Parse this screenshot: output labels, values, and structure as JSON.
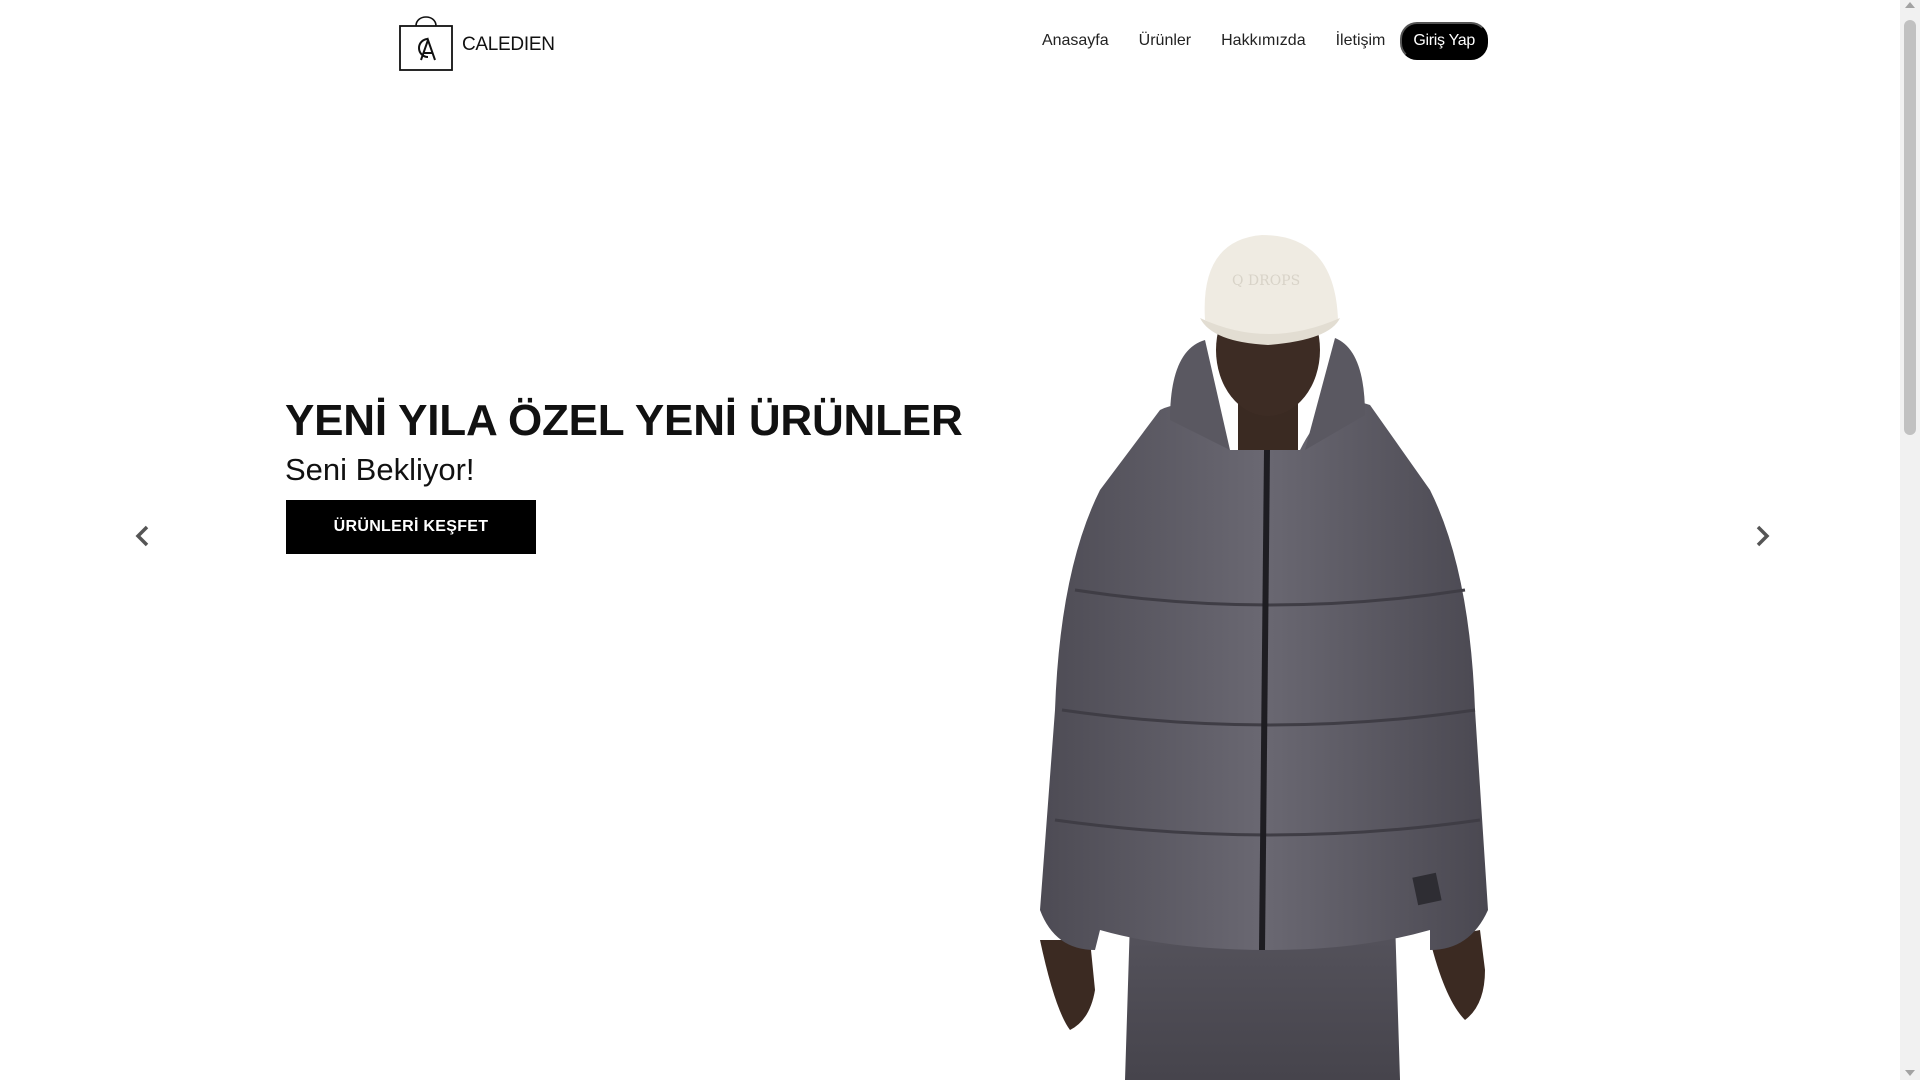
{
  "brand": {
    "name": "CALEDIEN",
    "monogram": "CA"
  },
  "nav": {
    "items": [
      {
        "label": "Anasayfa"
      },
      {
        "label": "Ürünler"
      },
      {
        "label": "Hakkımızda"
      },
      {
        "label": "İletişim"
      }
    ],
    "login_label": "Giriş Yap"
  },
  "hero": {
    "title": "YENİ YILA ÖZEL YENİ ÜRÜNLER",
    "subtitle": "Seni Bekliyor!",
    "cta_label": "ÜRÜNLERİ KEŞFET",
    "prev_icon": "chevron-left-icon",
    "next_icon": "chevron-right-icon",
    "cap_text": "Q DROPS"
  },
  "colors": {
    "accent": "#000000",
    "background": "#ffffff",
    "jacket": "#5f5d66",
    "cap": "#efebe2"
  }
}
